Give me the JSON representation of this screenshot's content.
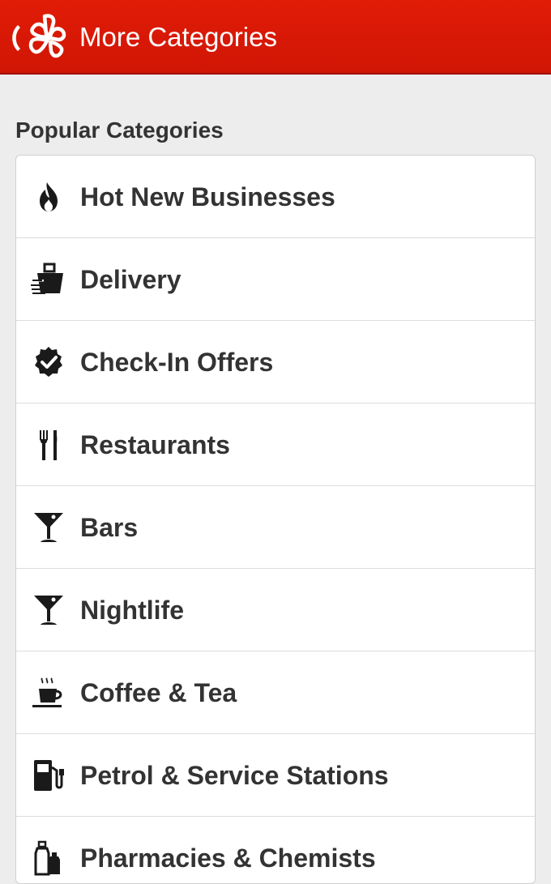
{
  "header": {
    "title": "More Categories",
    "back_icon": "chevron-left-icon",
    "logo_icon": "yelp-burst-logo",
    "color": "#d91806"
  },
  "section": {
    "title": "Popular Categories"
  },
  "categories": [
    {
      "label": "Hot New Businesses",
      "icon": "flame-icon"
    },
    {
      "label": "Delivery",
      "icon": "delivery-bag-icon"
    },
    {
      "label": "Check-In Offers",
      "icon": "badge-check-icon"
    },
    {
      "label": "Restaurants",
      "icon": "fork-knife-icon"
    },
    {
      "label": "Bars",
      "icon": "martini-glass-icon"
    },
    {
      "label": "Nightlife",
      "icon": "martini-glass-icon"
    },
    {
      "label": "Coffee & Tea",
      "icon": "coffee-cup-icon"
    },
    {
      "label": "Petrol & Service Stations",
      "icon": "fuel-pump-icon"
    },
    {
      "label": "Pharmacies & Chemists",
      "icon": "medicine-bottles-icon"
    }
  ]
}
